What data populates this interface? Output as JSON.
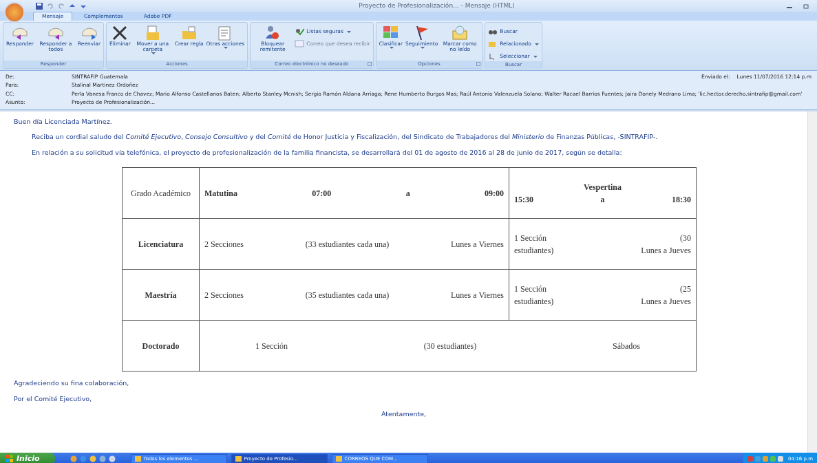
{
  "window": {
    "title": "Proyecto de Profesionalización... - Mensaje (HTML)"
  },
  "tabs": [
    {
      "label": "Mensaje",
      "selected": true
    },
    {
      "label": "Complementos",
      "selected": false
    },
    {
      "label": "Adobe PDF",
      "selected": false
    }
  ],
  "ribbon": [
    {
      "label": "Responder",
      "buttons": [
        {
          "label": "Responder",
          "kind": "large",
          "dropdown": false,
          "disabled": false
        },
        {
          "label": "Responder a todos",
          "kind": "large",
          "dropdown": false,
          "disabled": false
        },
        {
          "label": "Reenviar",
          "kind": "large",
          "dropdown": false,
          "disabled": false
        }
      ]
    },
    {
      "label": "Acciones",
      "buttons": [
        {
          "label": "Eliminar",
          "kind": "large",
          "dropdown": false,
          "disabled": false
        },
        {
          "label": "Mover a una carpeta",
          "kind": "large",
          "dropdown": true,
          "disabled": false
        },
        {
          "label": "Crear regla",
          "kind": "large",
          "dropdown": false,
          "disabled": false
        },
        {
          "label": "Otras acciones",
          "kind": "large",
          "dropdown": true,
          "disabled": false
        }
      ]
    },
    {
      "label": "Correo electrónico no deseado",
      "launcher": true,
      "buttons": [
        {
          "label": "Bloquear remitente",
          "kind": "large",
          "dropdown": false,
          "disabled": false
        },
        {
          "label": "Listas seguras",
          "kind": "small",
          "dropdown": true,
          "disabled": false
        },
        {
          "label": "Correo que desea recibir",
          "kind": "small",
          "dropdown": false,
          "disabled": true
        }
      ]
    },
    {
      "label": "Opciones",
      "launcher": true,
      "buttons": [
        {
          "label": "Clasificar",
          "kind": "large",
          "dropdown": true,
          "disabled": false
        },
        {
          "label": "Seguimiento",
          "kind": "large",
          "dropdown": true,
          "disabled": false
        },
        {
          "label": "Marcar como no leído",
          "kind": "large",
          "dropdown": false,
          "disabled": false
        }
      ]
    },
    {
      "label": "Buscar",
      "buttons": [
        {
          "label": "Buscar",
          "kind": "small",
          "dropdown": false,
          "disabled": false
        },
        {
          "label": "Relacionado",
          "kind": "small",
          "dropdown": true,
          "disabled": false
        },
        {
          "label": "Seleccionar",
          "kind": "small",
          "dropdown": true,
          "disabled": false
        }
      ]
    }
  ],
  "header": {
    "fields": [
      {
        "label": "De:",
        "value": "SINTRAFIP Guatemala"
      },
      {
        "label": "Para:",
        "value": "Stalinal Martinez Ordoñez"
      },
      {
        "label": "CC:",
        "value": "Perla Vanesa Franco de Chavez; Mario Alfonso Castellanos Baten; Alberto Stanley Mcnish; Sergio Ramón Aldana Arriaga; Rene Humberto Burgos Mas; Raúl Antonio Valenzuela Solano; Walter Racael Barrios Fuentes; Jaira Donely Medrano Lima; 'lic.hector.derecho.sintrafip@gmail.com'"
      },
      {
        "label": "Asunto:",
        "value": "Proyecto de Profesionalización..."
      }
    ],
    "sent_label": "Enviado el:",
    "sent_value": "Lunes 11/07/2016 12:14 p.m"
  },
  "body": {
    "greeting": "Buen día Licenciada Martínez.",
    "paragraphs": [
      "Reciba un cordial saludo del *Comité Ejecutivo*, *Consejo Consultivo* y del *Comité* de Honor Justicia y Fiscalización, del Sindicato de Trabajadores del *Ministerio* de Finanzas Públicas, -SINTRAFIP-.",
      "En relación a su solicitud vía telefónica, el proyecto de profesionalización de la familia financista, se desarrollará del 01 de agosto de 2016 al 28 de junio de 2017, según se detalla:"
    ],
    "table": [
      {
        "label": "Grado Académico",
        "bold": false,
        "cells": [
          {
            "bold": true,
            "lines": [
              [
                "Matutina",
                "07:00",
                "a",
                "09:00"
              ]
            ]
          },
          {
            "bold": true,
            "lines": [
              [
                "Vespertina"
              ],
              [
                "15:30",
                "a",
                "18:30"
              ]
            ]
          }
        ]
      },
      {
        "label": "Licenciatura",
        "bold": true,
        "cells": [
          {
            "bold": false,
            "lines": [
              [
                "2 Secciones",
                "(33 estudiantes cada una)",
                "Lunes a Viernes"
              ]
            ]
          },
          {
            "bold": false,
            "lines": [
              [
                "1 Sección",
                "(30"
              ],
              [
                "estudiantes)",
                "Lunes a Jueves"
              ]
            ]
          }
        ]
      },
      {
        "label": "Maestría",
        "bold": true,
        "cells": [
          {
            "bold": false,
            "lines": [
              [
                "2 Secciones",
                "(35 estudiantes cada una)",
                "Lunes a Viernes"
              ]
            ]
          },
          {
            "bold": false,
            "lines": [
              [
                "1 Sección",
                "(25"
              ],
              [
                "estudiantes)",
                "Lunes a Jueves"
              ]
            ]
          }
        ]
      },
      {
        "label": "Doctorado",
        "bold": true,
        "cells": [
          {
            "bold": false,
            "lines": [
              [
                "1 Sección",
                "(30 estudiantes)",
                "Sábados"
              ]
            ]
          }
        ]
      }
    ],
    "closing": [
      "Agradeciendo su fina colaboración,",
      "Por el Comité Ejecutivo,"
    ],
    "signoff": "Atentamente,"
  },
  "taskbar": {
    "start": "Inicio",
    "tasks": [
      {
        "label": "Todos los elementos ...",
        "selected": false
      },
      {
        "label": "Proyecto de Profesio...",
        "selected": true
      },
      {
        "label": "CORREOS QUE COM...",
        "selected": false
      }
    ],
    "clock": "04:16 p.m"
  }
}
